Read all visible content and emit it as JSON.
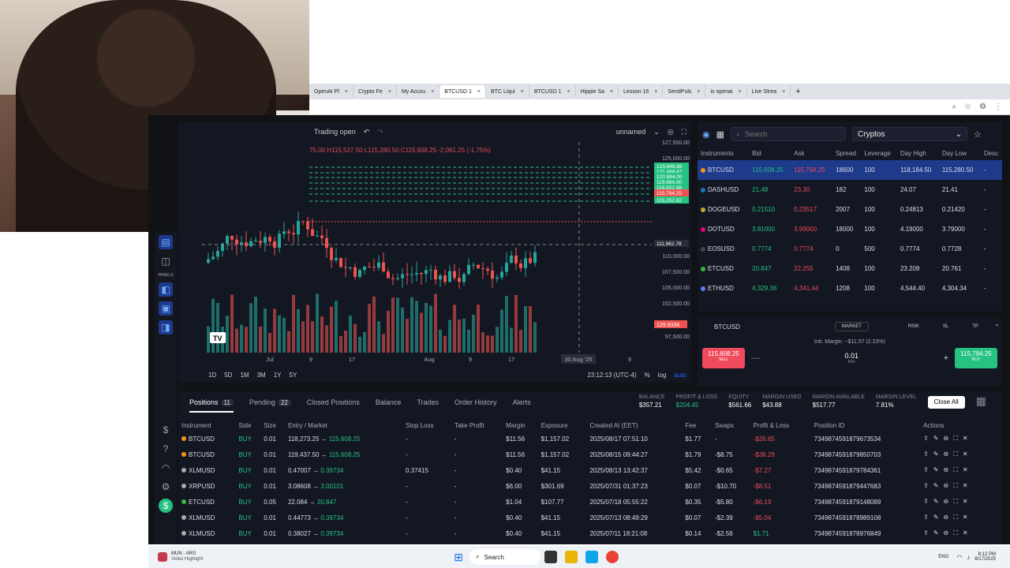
{
  "browser": {
    "tabs": [
      {
        "label": "OpenAI Pl"
      },
      {
        "label": "Crypto Fe"
      },
      {
        "label": "My Accou"
      },
      {
        "label": "BTCUSD 1",
        "active": true
      },
      {
        "label": "BTC Liqui"
      },
      {
        "label": "BTCUSD 1"
      },
      {
        "label": "Hippie Sa"
      },
      {
        "label": "Lesson 16"
      },
      {
        "label": "SendPuls"
      },
      {
        "label": "is openai"
      },
      {
        "label": "Live Strea"
      }
    ]
  },
  "chart": {
    "status": "Trading open",
    "layout": "unnamed",
    "ohlc": "75.00 H115,527.50 L115,280.50 C115,608.25 -2,061.25 (-1.75%)",
    "y_ticks": [
      "127,500.00",
      "125,000.00",
      "110,000.00",
      "107,500.00",
      "105,000.00",
      "102,500.00",
      "97,500.00"
    ],
    "price_tags": [
      "123,848.88",
      "121,888.87",
      "120,884.00",
      "119,984.00",
      "118,822.88",
      "115,794.25",
      "115,202.62",
      "111,962.78"
    ],
    "vol_tag": "129.933K",
    "x_ticks": [
      "Jul",
      "9",
      "17",
      "Aug",
      "9",
      "17",
      "30 Aug '25",
      "9"
    ],
    "ranges": [
      "1D",
      "5D",
      "1M",
      "3M",
      "1Y",
      "5Y"
    ],
    "time": "23:12:13 (UTC-4)",
    "pct": "%",
    "log": "log",
    "auto": "auto",
    "left_panel_label": "PANELS"
  },
  "instruments": {
    "search_placeholder": "Search",
    "category": "Cryptos",
    "headers": [
      "Instruments",
      "Bid",
      "Ask",
      "Spread",
      "Leverage",
      "Day High",
      "Day Low",
      "Desc"
    ],
    "rows": [
      {
        "name": "BTCUSD",
        "bid": "115,608.25",
        "ask": "115,794.25",
        "spread": "18600",
        "lev": "100",
        "high": "118,184.50",
        "low": "115,280.50",
        "desc": "-",
        "color": "#f7931a"
      },
      {
        "name": "DASHUSD",
        "bid": "21.48",
        "ask": "23.30",
        "spread": "182",
        "lev": "100",
        "high": "24.07",
        "low": "21.41",
        "desc": "-",
        "color": "#1c75bc"
      },
      {
        "name": "DOGEUSD",
        "bid": "0.21510",
        "ask": "0.23517",
        "spread": "2007",
        "lev": "100",
        "high": "0.24813",
        "low": "0.21420",
        "desc": "-",
        "color": "#c2a633"
      },
      {
        "name": "DOTUSD",
        "bid": "3.81000",
        "ask": "3.99000",
        "spread": "18000",
        "lev": "100",
        "high": "4.19000",
        "low": "3.79000",
        "desc": "-",
        "color": "#e6007a"
      },
      {
        "name": "EOSUSD",
        "bid": "0.7774",
        "ask": "0.7774",
        "spread": "0",
        "lev": "500",
        "high": "0.7774",
        "low": "0.7728",
        "desc": "-",
        "color": "#444"
      },
      {
        "name": "ETCUSD",
        "bid": "20.847",
        "ask": "22.255",
        "spread": "1408",
        "lev": "100",
        "high": "23.208",
        "low": "20.761",
        "desc": "-",
        "color": "#3ab83a"
      },
      {
        "name": "ETHUSD",
        "bid": "4,329.36",
        "ask": "4,341.44",
        "spread": "1208",
        "lev": "100",
        "high": "4,544.40",
        "low": "4,304.34",
        "desc": "-",
        "color": "#627eea"
      }
    ]
  },
  "order": {
    "symbol": "BTCUSD",
    "type": "MARKET",
    "risk": "RISK",
    "sl": "SL",
    "tp": "TP",
    "margin": "Init. Margin: ~$11.57 (2.23%)",
    "sell_price": "115,608.25",
    "sell": "SELL",
    "qty": "0.01",
    "unit": "lots",
    "buy_price": "115,794.25",
    "buy": "BUY"
  },
  "positions": {
    "tabs": [
      {
        "label": "Positions",
        "count": "11"
      },
      {
        "label": "Pending",
        "count": "22"
      },
      {
        "label": "Closed Positions"
      },
      {
        "label": "Balance"
      },
      {
        "label": "Trades"
      },
      {
        "label": "Order History"
      },
      {
        "label": "Alerts"
      }
    ],
    "stats": [
      {
        "k": "BALANCE",
        "v": "$357.21"
      },
      {
        "k": "PROFIT & LOSS",
        "v": "$204.45"
      },
      {
        "k": "EQUITY",
        "v": "$561.66"
      },
      {
        "k": "MARGIN USED",
        "v": "$43.88"
      },
      {
        "k": "MARGIN AVAILABLE",
        "v": "$517.77"
      },
      {
        "k": "MARGIN LEVEL",
        "v": "7.81%"
      }
    ],
    "close_all": "Close All",
    "headers": [
      "Instrument",
      "Side",
      "Size",
      "Entry / Market",
      "Stop Loss",
      "Take Profit",
      "Margin",
      "Exposure",
      "Created At (EET)",
      "Fee",
      "Swaps",
      "Profit & Loss",
      "Position ID",
      "Actions"
    ],
    "rows": [
      {
        "inst": "BTCUSD",
        "side": "BUY",
        "size": "0.01",
        "entry": "118,273.25",
        "market": "115,608.25",
        "sl": "-",
        "tp": "-",
        "margin": "$11.56",
        "exp": "$1,157.02",
        "created": "2025/08/17 07:51:10",
        "fee": "$1.77",
        "swaps": "-",
        "pl": "-$26.65",
        "id": "7349874591879673534",
        "color": "#f7931a"
      },
      {
        "inst": "BTCUSD",
        "side": "BUY",
        "size": "0.01",
        "entry": "119,437.50",
        "market": "115,608.25",
        "sl": "-",
        "tp": "-",
        "margin": "$11.56",
        "exp": "$1,157.02",
        "created": "2025/08/15 09:44:27",
        "fee": "$1.79",
        "swaps": "-$8.75",
        "pl": "-$38.29",
        "id": "7349874591879850703",
        "color": "#f7931a"
      },
      {
        "inst": "XLMUSD",
        "side": "BUY",
        "size": "0.01",
        "entry": "0.47007",
        "market": "0.39734",
        "sl": "0.37415",
        "tp": "-",
        "margin": "$0.40",
        "exp": "$41.15",
        "created": "2025/08/13 13:42:37",
        "fee": "$5.42",
        "swaps": "-$0.65",
        "pl": "-$7.27",
        "id": "7349874591879784361",
        "color": "#aaa"
      },
      {
        "inst": "XRPUSD",
        "side": "BUY",
        "size": "0.01",
        "entry": "3.08608",
        "market": "3.00101",
        "sl": "-",
        "tp": "-",
        "margin": "$6.00",
        "exp": "$301.69",
        "created": "2025/07/31 01:37:23",
        "fee": "$0.07",
        "swaps": "-$10.70",
        "pl": "-$8.51",
        "id": "7349874591879447683",
        "color": "#aaa"
      },
      {
        "inst": "ETCUSD",
        "side": "BUY",
        "size": "0.05",
        "entry": "22.084",
        "market": "20.847",
        "sl": "-",
        "tp": "-",
        "margin": "$1.04",
        "exp": "$107.77",
        "created": "2025/07/18 05:55:22",
        "fee": "$0.35",
        "swaps": "-$5.80",
        "pl": "-$6.19",
        "id": "7349874591879148089",
        "color": "#3ab83a"
      },
      {
        "inst": "XLMUSD",
        "side": "BUY",
        "size": "0.01",
        "entry": "0.44773",
        "market": "0.39734",
        "sl": "-",
        "tp": "-",
        "margin": "$0.40",
        "exp": "$41.15",
        "created": "2025/07/13 08:49:29",
        "fee": "$0.07",
        "swaps": "-$2.39",
        "pl": "-$5.04",
        "id": "7349874591878989108",
        "color": "#aaa"
      },
      {
        "inst": "XLMUSD",
        "side": "BUY",
        "size": "0.01",
        "entry": "0.38027",
        "market": "0.39734",
        "sl": "-",
        "tp": "-",
        "margin": "$0.40",
        "exp": "$41.15",
        "created": "2025/07/11 18:21:08",
        "fee": "$0.14",
        "swaps": "-$2.56",
        "pl": "$1.71",
        "id": "7349874591878976849",
        "color": "#aaa"
      }
    ]
  },
  "taskbar": {
    "app_name": "MUN - ARS",
    "app_sub": "Video Highlight",
    "search": "Search",
    "lang": "ENG",
    "time": "8:12 PM",
    "date": "8/17/2025"
  }
}
